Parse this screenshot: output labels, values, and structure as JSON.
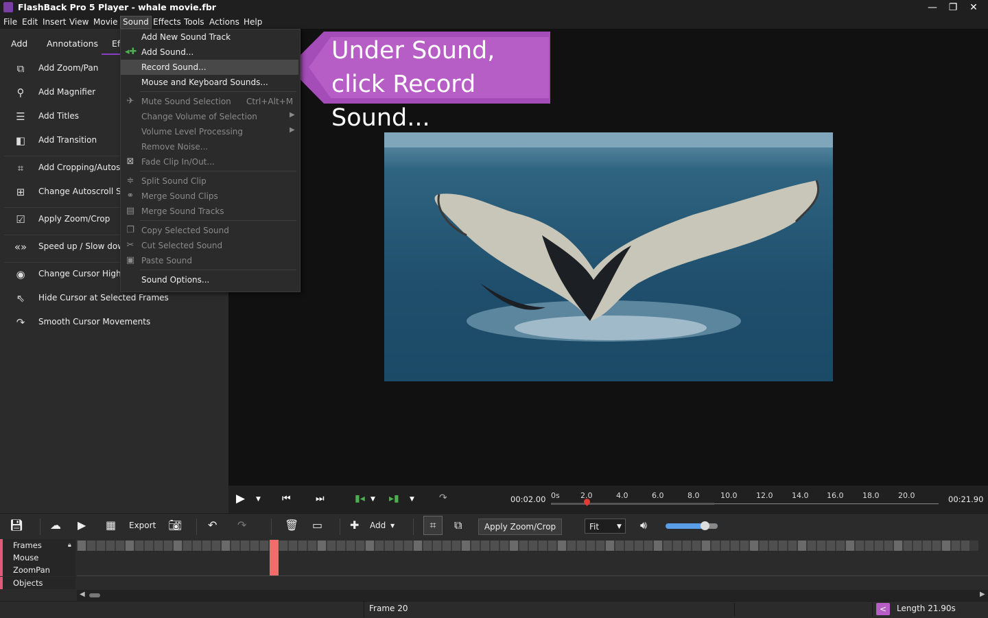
{
  "window": {
    "title": "FlashBack Pro 5 Player - whale movie.fbr",
    "controls": {
      "minimize": "—",
      "restore": "❐",
      "close": "✕"
    }
  },
  "menubar": {
    "items": [
      "File",
      "Edit",
      "Insert",
      "View",
      "Movie",
      "Sound",
      "Effects",
      "Tools",
      "Actions",
      "Help"
    ],
    "active": "Sound"
  },
  "left_panel": {
    "tabs": [
      "Add",
      "Annotations",
      "Ef"
    ],
    "items": [
      {
        "label": "Add Zoom/Pan",
        "icon": "zoom-pan-icon"
      },
      {
        "label": "Add Magnifier",
        "icon": "magnifier-icon"
      },
      {
        "label": "Add Titles",
        "icon": "titles-icon"
      },
      {
        "label": "Add Transition",
        "icon": "transition-icon"
      },
      {
        "label": "Add Cropping/Autosc",
        "icon": "crop-icon"
      },
      {
        "label": "Change Autoscroll Set",
        "icon": "autoscroll-icon"
      },
      {
        "label": "Apply Zoom/Crop",
        "icon": "checkbox-icon"
      },
      {
        "label": "Speed up / Slow down",
        "icon": "speed-icon"
      },
      {
        "label": "Change Cursor Highlig",
        "icon": "cursor-highlight-icon"
      },
      {
        "label": "Hide Cursor at Selected Frames",
        "icon": "cursor-icon"
      },
      {
        "label": "Smooth Cursor Movements",
        "icon": "smooth-cursor-icon"
      }
    ]
  },
  "sound_menu": {
    "items": [
      {
        "label": "Add New Sound Track",
        "enabled": true,
        "icon": ""
      },
      {
        "label": "Add Sound...",
        "enabled": true,
        "icon": "add-sound-icon"
      },
      {
        "label": "Record Sound...",
        "enabled": true,
        "icon": "",
        "highlighted": true
      },
      {
        "label": "Mouse and Keyboard Sounds...",
        "enabled": true,
        "icon": ""
      },
      {
        "label": "Mute Sound Selection",
        "enabled": false,
        "icon": "mute-icon",
        "shortcut": "Ctrl+Alt+M"
      },
      {
        "label": "Change Volume of Selection",
        "enabled": false,
        "icon": "",
        "submenu": true
      },
      {
        "label": "Volume Level Processing",
        "enabled": false,
        "icon": "",
        "submenu": true
      },
      {
        "label": "Remove Noise...",
        "enabled": false,
        "icon": ""
      },
      {
        "label": "Fade Clip In/Out...",
        "enabled": false,
        "icon": "fade-icon"
      },
      {
        "label": "Split Sound Clip",
        "enabled": false,
        "icon": "split-icon"
      },
      {
        "label": "Merge Sound Clips",
        "enabled": false,
        "icon": "merge-clips-icon"
      },
      {
        "label": "Merge Sound Tracks",
        "enabled": false,
        "icon": "merge-tracks-icon"
      },
      {
        "label": "Copy Selected Sound",
        "enabled": false,
        "icon": "copy-icon"
      },
      {
        "label": "Cut Selected Sound",
        "enabled": false,
        "icon": "cut-icon"
      },
      {
        "label": "Paste Sound",
        "enabled": false,
        "icon": "paste-icon"
      },
      {
        "label": "Sound Options...",
        "enabled": true,
        "icon": ""
      }
    ]
  },
  "callout": {
    "text": "Under Sound, click Record Sound...",
    "color": "#b65ec6"
  },
  "transport": {
    "current_time": "00:02.00",
    "total_time": "00:21.90",
    "ruler_ticks": [
      "0s",
      "2.0",
      "4.0",
      "6.0",
      "8.0",
      "10.0",
      "12.0",
      "14.0",
      "16.0",
      "18.0",
      "20.0"
    ]
  },
  "toolbar": {
    "export_label": "Export",
    "add_label": "Add",
    "apply_zoom_label": "Apply Zoom/Crop",
    "fit_value": "Fit",
    "volume_level": 0.75
  },
  "timeline": {
    "tracks": [
      "Frames",
      "Mouse",
      "ZoomPan",
      "Objects"
    ],
    "current_frame_index": 20
  },
  "statusbar": {
    "frame_text": "Frame 20",
    "length_text": "Length 21.90s"
  },
  "colors": {
    "accent": "#8b3fc6",
    "playhead": "#e53935",
    "frame_marker": "#f26c6c",
    "track_marker": "#e05a7a"
  }
}
